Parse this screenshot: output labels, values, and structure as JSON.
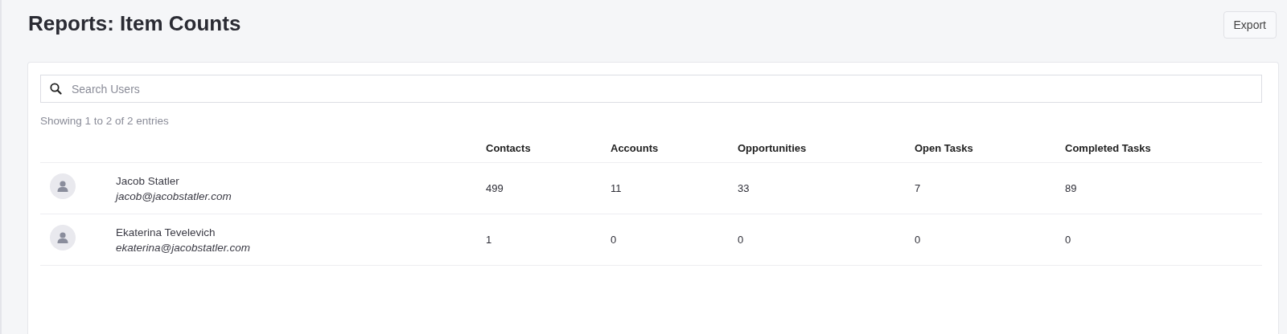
{
  "page": {
    "title": "Reports: Item Counts",
    "export_button": "Export"
  },
  "search": {
    "placeholder": "Search Users"
  },
  "summary": "Showing 1 to 2 of 2 entries",
  "table": {
    "columns": [
      "Contacts",
      "Accounts",
      "Opportunities",
      "Open Tasks",
      "Completed Tasks"
    ],
    "rows": [
      {
        "name": "Jacob Statler",
        "email": "jacob@jacobstatler.com",
        "values": [
          "499",
          "11",
          "33",
          "7",
          "89"
        ]
      },
      {
        "name": "Ekaterina Tevelevich",
        "email": "ekaterina@jacobstatler.com",
        "values": [
          "1",
          "0",
          "0",
          "0",
          "0"
        ]
      }
    ]
  }
}
